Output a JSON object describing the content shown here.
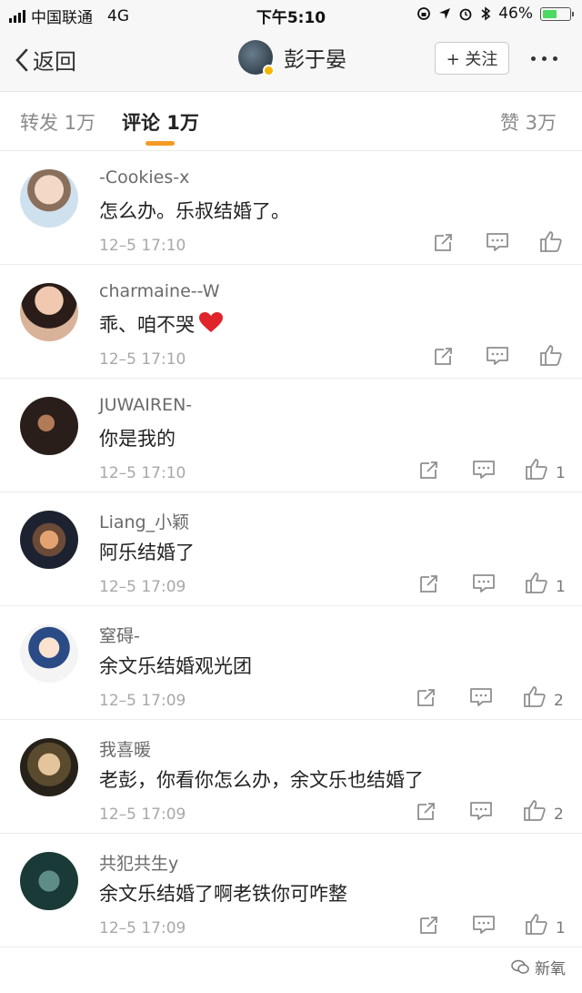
{
  "status_bar": {
    "carrier": "中国联通",
    "network": "4G",
    "time": "下午5:10",
    "battery": "46%",
    "battery_level": 0.46
  },
  "nav": {
    "back_label": "返回",
    "title": "彭于晏",
    "follow_label": "+ 关注"
  },
  "tabs": {
    "repost": "转发 1万",
    "comment": "评论 1万",
    "like": "赞 3万"
  },
  "comments": [
    {
      "user": "-Cookies-x",
      "text": "怎么办。乐叔结婚了。",
      "time": "12–5 17:10",
      "likes": "",
      "heart": false
    },
    {
      "user": "charmaine--W",
      "text": "乖、咱不哭",
      "time": "12–5 17:10",
      "likes": "",
      "heart": true
    },
    {
      "user": "JUWAIREN-",
      "text": "你是我的",
      "time": "12–5 17:10",
      "likes": "1",
      "heart": false
    },
    {
      "user": "Liang_小颖",
      "text": "阿乐结婚了",
      "time": "12–5 17:09",
      "likes": "1",
      "heart": false
    },
    {
      "user": "窒碍-",
      "text": "余文乐结婚观光团",
      "time": "12–5 17:09",
      "likes": "2",
      "heart": false
    },
    {
      "user": "我喜暖",
      "text": "老彭，你看你怎么办，余文乐也结婚了",
      "time": "12–5 17:09",
      "likes": "2",
      "heart": false
    },
    {
      "user": "共犯共生y",
      "text": "余文乐结婚了啊老铁你可咋整",
      "time": "12–5 17:09",
      "likes": "1",
      "heart": false
    }
  ],
  "watermark": "新氧",
  "colors": {
    "accent": "#f59b23",
    "heart": "#e0242b",
    "verified": "#f5b400"
  }
}
